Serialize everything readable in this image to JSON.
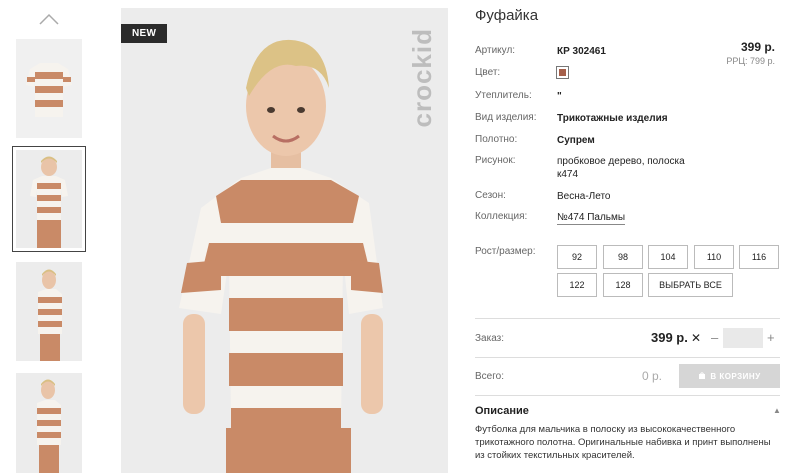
{
  "badge": "NEW",
  "brand": "crockid",
  "product": {
    "title": "Фуфайка",
    "price": "399 р.",
    "rrc_price": "РРЦ: 799 р."
  },
  "attributes": [
    {
      "label": "Артикул:",
      "value": "КР 302461",
      "bold": true
    },
    {
      "label": "Цвет:",
      "value": "",
      "swatch": "#a55f4a"
    },
    {
      "label": "Утеплитель:",
      "value": "\"",
      "bold": true
    },
    {
      "label": "Вид изделия:",
      "value": "Трикотажные изделия",
      "bold": true
    },
    {
      "label": "Полотно:",
      "value": "Супрем",
      "bold": true
    },
    {
      "label": "Рисунок:",
      "value": "пробковое дерево, полоска к474",
      "bold": false
    },
    {
      "label": "Сезон:",
      "value": "Весна-Лето",
      "bold": false
    },
    {
      "label": "Коллекция:",
      "value": "№474 Пальмы",
      "bold": false,
      "link": true
    }
  ],
  "sizes": {
    "label": "Рост/размер:",
    "options": [
      "92",
      "98",
      "104",
      "110",
      "116",
      "122",
      "128"
    ],
    "select_all": "ВЫБРАТЬ ВСЕ"
  },
  "order": {
    "label": "Заказ:",
    "price": "399 р.",
    "times": "✕",
    "minus": "–",
    "plus": "+",
    "qty": ""
  },
  "total": {
    "label": "Всего:",
    "value": "0 р.",
    "cart_button": "В КОРЗИНУ"
  },
  "description": {
    "title": "Описание",
    "toggle": "▲",
    "text": "Футболка для мальчика в полоску из высококачественного трикотажного полотна. Оригинальные набивка и принт выполнены из стойких текстильных красителей."
  },
  "colors": {
    "stripe_brown": "#c98a67",
    "stripe_white": "#f5f2ec",
    "background": "#ececec"
  }
}
